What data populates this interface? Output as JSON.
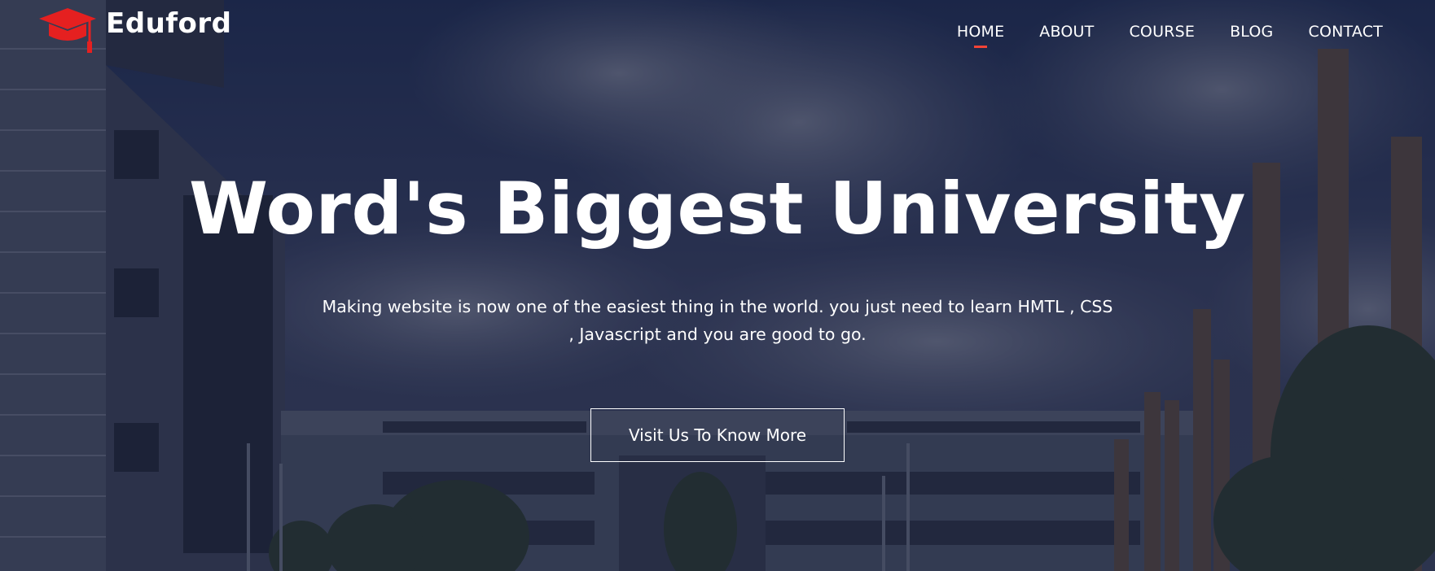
{
  "brand": {
    "name": "Eduford",
    "logo_icon": "graduation-cap-icon",
    "accent": "#e52020"
  },
  "nav": {
    "items": [
      {
        "label": "HOME",
        "active": true
      },
      {
        "label": "ABOUT",
        "active": false
      },
      {
        "label": "COURSE",
        "active": false
      },
      {
        "label": "BLOG",
        "active": false
      },
      {
        "label": "CONTACT",
        "active": false
      }
    ],
    "active_indicator_color": "#f44336"
  },
  "hero": {
    "title": "Word's Biggest University",
    "subtitle": "Making website is now one of the easiest thing in the world. you just need to learn HMTL , CSS , Javascript and you are good to go.",
    "cta_label": "Visit Us To Know More"
  }
}
